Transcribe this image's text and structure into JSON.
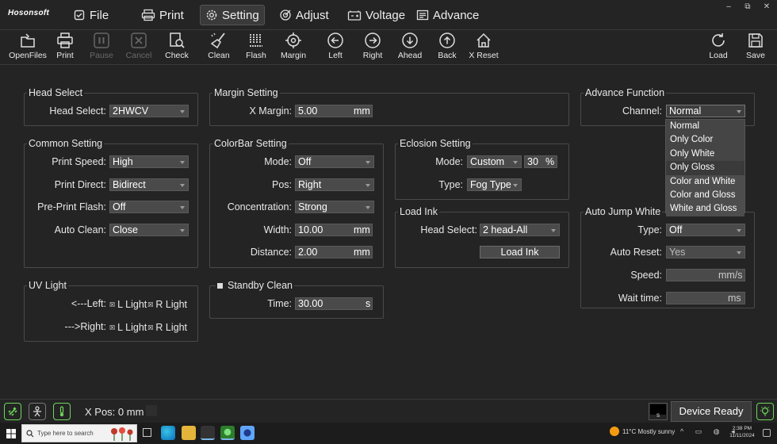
{
  "app": {
    "logo": "Hosonsoft"
  },
  "menu": {
    "file": "File",
    "print": "Print",
    "setting": "Setting",
    "adjust": "Adjust",
    "voltage": "Voltage",
    "advance": "Advance"
  },
  "window_controls": {
    "minimize": "–",
    "restore": "⧉",
    "close": "✕"
  },
  "toolbar": {
    "openfiles": "OpenFiles",
    "print": "Print",
    "pause": "Pause",
    "cancel": "Cancel",
    "check": "Check",
    "clean": "Clean",
    "flash": "Flash",
    "margin": "Margin",
    "left": "Left",
    "right": "Right",
    "ahead": "Ahead",
    "back": "Back",
    "xreset": "X Reset",
    "load": "Load",
    "save": "Save"
  },
  "head_select": {
    "title": "Head Select",
    "label": "Head Select:",
    "value": "2HWCV"
  },
  "margin_setting": {
    "title": "Margin Setting",
    "label": "X Margin:",
    "value": "5.00",
    "unit": "mm"
  },
  "advance_function": {
    "title": "Advance Function",
    "label": "Channel:",
    "value": "Normal",
    "options": [
      "Normal",
      "Only Color",
      "Only White",
      "Only Gloss",
      "Color and White",
      "Color and Gloss",
      "White and Gloss"
    ]
  },
  "common_setting": {
    "title": "Common Setting",
    "print_speed": {
      "label": "Print Speed:",
      "value": "High"
    },
    "print_direct": {
      "label": "Print Direct:",
      "value": "Bidirect"
    },
    "pre_print_flash": {
      "label": "Pre-Print Flash:",
      "value": "Off"
    },
    "auto_clean": {
      "label": "Auto Clean:",
      "value": "Close"
    }
  },
  "colorbar_setting": {
    "title": "ColorBar Setting",
    "mode": {
      "label": "Mode:",
      "value": "Off"
    },
    "pos": {
      "label": "Pos:",
      "value": "Right"
    },
    "concentration": {
      "label": "Concentration:",
      "value": "Strong"
    },
    "width": {
      "label": "Width:",
      "value": "10.00",
      "unit": "mm"
    },
    "distance": {
      "label": "Distance:",
      "value": "2.00",
      "unit": "mm"
    }
  },
  "eclosion_setting": {
    "title": "Eclosion Setting",
    "mode": {
      "label": "Mode:",
      "value": "Custom",
      "percent": "30",
      "unit": "%"
    },
    "type": {
      "label": "Type:",
      "value": "Fog Type"
    }
  },
  "load_ink": {
    "title": "Load Ink",
    "label": "Head Select:",
    "value": "2 head-All",
    "button": "Load Ink"
  },
  "auto_jump_white": {
    "title": "Auto Jump White",
    "type": {
      "label": "Type:",
      "value": "Off"
    },
    "auto_reset": {
      "label": "Auto Reset:",
      "value": "Yes"
    },
    "speed": {
      "label": "Speed:",
      "unit": "mm/s"
    },
    "wait_time": {
      "label": "Wait time:",
      "unit": "ms"
    }
  },
  "uv_light": {
    "title": "UV Light",
    "left_label": "<---Left:",
    "right_label": "--->Right:",
    "l_light": "L Light",
    "r_light": "R Light"
  },
  "standby_clean": {
    "title": "Standby Clean",
    "label": "Time:",
    "value": "30.00",
    "unit": "s"
  },
  "status": {
    "xpos": "X Pos: 0 mm",
    "device": "Device Ready",
    "ink_label": "S"
  },
  "taskbar": {
    "search_placeholder": "Type here to search",
    "weather": "11°C  Mostly sunny",
    "time": "2:38 PM",
    "date": "11/11/2024"
  }
}
